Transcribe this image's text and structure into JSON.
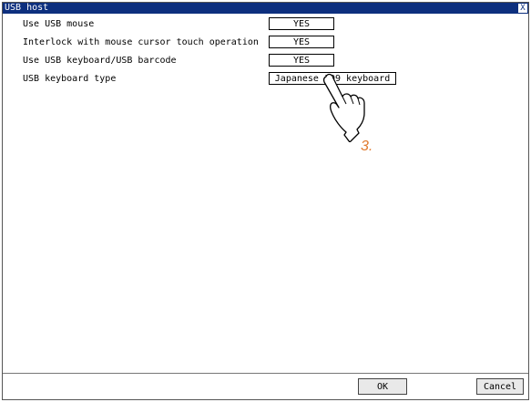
{
  "window": {
    "title": "USB host",
    "close_glyph": "X"
  },
  "settings": [
    {
      "label": "Use USB mouse",
      "value": "YES"
    },
    {
      "label": "Interlock with mouse cursor touch operation",
      "value": "YES"
    },
    {
      "label": "Use USB keyboard/USB barcode",
      "value": "YES"
    },
    {
      "label": "USB keyboard type",
      "value": "Japanese 109 keyboard"
    }
  ],
  "buttons": {
    "ok": "OK",
    "cancel": "Cancel"
  },
  "annotation": {
    "step": "3.",
    "step_color": "#e07a2f",
    "pointer_icon": "pointing-hand-icon"
  },
  "colors": {
    "titlebar": "#0d2f7e"
  }
}
